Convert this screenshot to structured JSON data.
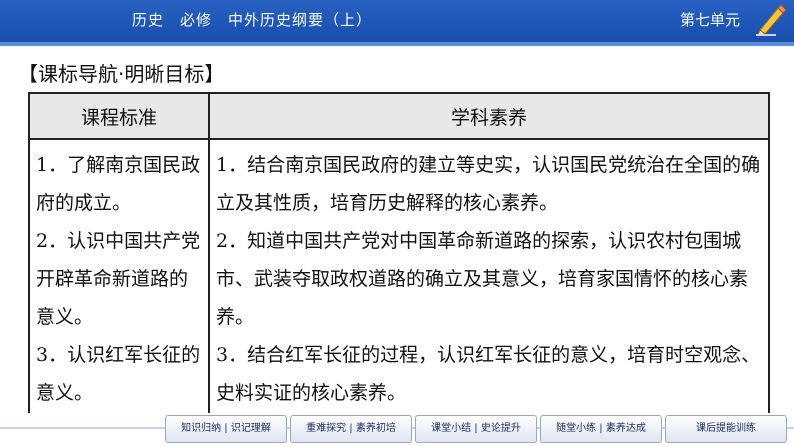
{
  "header": {
    "title": "历史　必修　中外历史纲要（上）",
    "unit": "第七单元"
  },
  "section_title": "【课标导航·明晰目标】",
  "table": {
    "headers": [
      "课程标准",
      "学科素养"
    ],
    "standards": [
      "1．了解南京国民政府的成立。",
      "2．认识中国共产党开辟革命新道路的意义。",
      "3．认识红军长征的意义。"
    ],
    "literacy": [
      "1．结合南京国民政府的建立等史实，认识国民党统治在全国的确立及其性质，培育历史解释的核心素养。",
      "2．知道中国共产党对中国革命新道路的探索，认识农村包围城市、武装夺取政权道路的确立及其意义，培育家国情怀的核心素养。",
      "3．结合红军长征的过程，认识红军长征的意义，培育时空观念、史料实证的核心素养。"
    ]
  },
  "footer": {
    "nav": [
      "知识归纳 | 识记理解",
      "重难探究 | 素养初培",
      "课堂小结 | 史论提升",
      "随堂小练 | 素养达成",
      "课后提能训练"
    ]
  },
  "colors": {
    "header_bg": "#1e56b8",
    "table_header_bg": "#e8e8e8",
    "nav_text": "#1c2f66"
  }
}
